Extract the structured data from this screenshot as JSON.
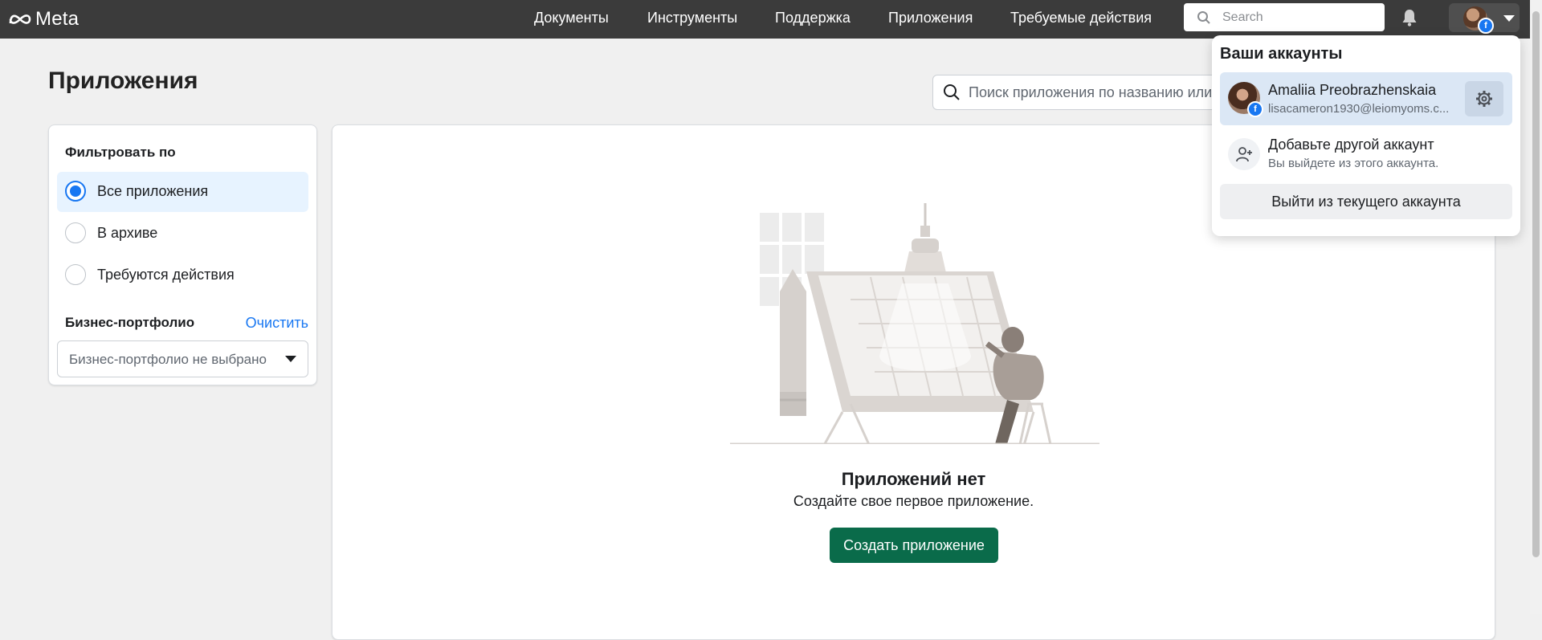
{
  "header": {
    "logo_text": "Meta",
    "nav": [
      "Документы",
      "Инструменты",
      "Поддержка",
      "Приложения",
      "Требуемые действия"
    ],
    "search_placeholder": "Search"
  },
  "page": {
    "title": "Приложения",
    "search_placeholder": "Поиск приложения по названию или I"
  },
  "filter": {
    "title": "Фильтровать по",
    "options": [
      {
        "label": "Все приложения",
        "selected": true
      },
      {
        "label": "В архиве",
        "selected": false
      },
      {
        "label": "Требуются действия",
        "selected": false
      }
    ],
    "business_title": "Бизнес-портфолио",
    "clear_label": "Очистить",
    "business_value": "Бизнес-портфолио не выбрано"
  },
  "empty_state": {
    "title": "Приложений нет",
    "subtitle": "Создайте свое первое приложение.",
    "create_button": "Создать приложение"
  },
  "accounts_menu": {
    "title": "Ваши аккаунты",
    "account": {
      "name": "Amaliia Preobrazhenskaia",
      "email": "lisacameron1930@leiomyoms.c..."
    },
    "add_account": {
      "label": "Добавьте другой аккаунт",
      "sublabel": "Вы выйдете из этого аккаунта."
    },
    "logout_label": "Выйти из текущего аккаунта"
  },
  "colors": {
    "topbar": "#3b3b3b",
    "accent": "#1877f2",
    "create_button": "#0a6b4a"
  },
  "icons": [
    "meta-logo-icon",
    "search-icon",
    "bell-icon",
    "avatar",
    "facebook-badge-icon",
    "chevron-down-icon",
    "gear-icon",
    "add-person-icon",
    "radio-icon"
  ]
}
